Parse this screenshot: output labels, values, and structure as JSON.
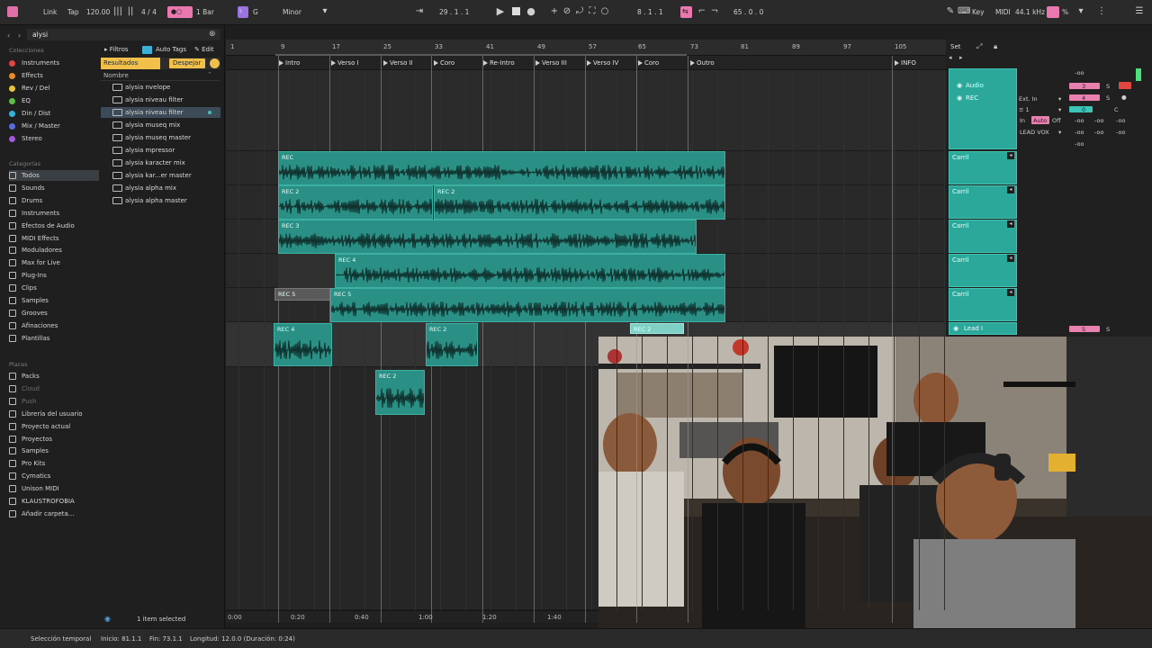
{
  "toolbar": {
    "link": "Link",
    "tap": "Tap",
    "tempo": "120.00",
    "signature": "4 / 4",
    "quantize": "1 Bar",
    "key": "G",
    "scale": "Minor",
    "position": "29 .   1 .   1",
    "loop_start": "8 .   1 .   1",
    "loop_length": "65 .   0 .   0",
    "key_label": "Key",
    "midi_label": "MIDI",
    "sample_rate": "44.1 kHz",
    "cpu_percent": "%"
  },
  "browser": {
    "search_value": "alysi",
    "collections_header": "Colecciones",
    "collections": [
      {
        "label": "Instruments",
        "color": "#e0473f"
      },
      {
        "label": "Effects",
        "color": "#e88a2d"
      },
      {
        "label": "Rev / Del",
        "color": "#e9c23f"
      },
      {
        "label": "EQ",
        "color": "#5bbf4a"
      },
      {
        "label": "Din / Dist",
        "color": "#36b0d8"
      },
      {
        "label": "Mix / Master",
        "color": "#5b6bdb"
      },
      {
        "label": "Stereo",
        "color": "#a25ad9"
      }
    ],
    "categories_header": "Categorías",
    "categories": [
      {
        "label": "Todos",
        "selected": true
      },
      {
        "label": "Sounds"
      },
      {
        "label": "Drums"
      },
      {
        "label": "Instruments"
      },
      {
        "label": "Efectos de Audio"
      },
      {
        "label": "MIDI Effects"
      },
      {
        "label": "Moduladores"
      },
      {
        "label": "Max for Live"
      },
      {
        "label": "Plug-Ins"
      },
      {
        "label": "Clips"
      },
      {
        "label": "Samples"
      },
      {
        "label": "Grooves"
      },
      {
        "label": "Afinaciones"
      },
      {
        "label": "Plantillas"
      }
    ],
    "places_header": "Places",
    "places": [
      {
        "label": "Packs"
      },
      {
        "label": "Cloud",
        "dim": true
      },
      {
        "label": "Push",
        "dim": true
      },
      {
        "label": "Librería del usuario"
      },
      {
        "label": "Proyecto actual"
      },
      {
        "label": "Proyectos"
      },
      {
        "label": "Samples"
      },
      {
        "label": "Pro Kits"
      },
      {
        "label": "Cymatics"
      },
      {
        "label": "Unison MIDI"
      },
      {
        "label": "KLAUSTROFOBIA"
      },
      {
        "label": "Añadir carpeta..."
      }
    ],
    "filters_label": "Filtros",
    "auto_tags_label": "Auto Tags",
    "edit_label": "Edit",
    "results_label": "Resultados",
    "clear_label": "Despejar",
    "name_header": "Nombre",
    "results": [
      {
        "label": "alysia nvelope"
      },
      {
        "label": "alysia niveau filter"
      },
      {
        "label": "alysia niveau filter",
        "selected": true
      },
      {
        "label": "alysia museq mix"
      },
      {
        "label": "alysia museq master"
      },
      {
        "label": "alysia mpressor"
      },
      {
        "label": "alysia karacter mix"
      },
      {
        "label": "alysia kar...er master"
      },
      {
        "label": "alysia alpha mix"
      },
      {
        "label": "alysia alpha master"
      }
    ],
    "selection_count": "1 item selected"
  },
  "arrangement": {
    "bar_numbers": [
      "1",
      "9",
      "17",
      "25",
      "33",
      "41",
      "49",
      "57",
      "65",
      "73",
      "81",
      "89",
      "97",
      "105"
    ],
    "locators": [
      "Intro",
      "Verso I",
      "Verso II",
      "Coro",
      "Re-Intro",
      "Verso III",
      "Verso IV",
      "Coro",
      "Outro",
      "INFO"
    ],
    "clips": [
      "REC",
      "REC 2",
      "REC 2",
      "REC 3",
      "REC 4",
      "REC 5",
      "REC 5",
      "REC 4",
      "REC 2",
      "REC 2",
      "REC 2"
    ],
    "time_markers": [
      "0:00",
      "0:20",
      "0:40",
      "1:00",
      "1:20",
      "1:40"
    ]
  },
  "mixer": {
    "set_label": "Set",
    "input_label": "Audio",
    "rec_label": "REC",
    "ext_in": "Ext. In",
    "channel": "1",
    "monitor_in": "In",
    "monitor_auto": "Auto",
    "monitor_off": "Off",
    "track_name": "LEAD VOX",
    "inf": "-oo",
    "send_value_a": "3",
    "send_value_b": "4",
    "solo": "S",
    "pan": "C",
    "zero": "0",
    "lanes": [
      "Carril",
      "Carril",
      "Carril",
      "Carril",
      "Carril"
    ],
    "lead_label": "Lead I",
    "lead_value": "5"
  },
  "status_bar": {
    "selection": "Selección temporal",
    "start": "Inicio: 81.1.1",
    "end": "Fin: 73.1.1",
    "length": "Longitud: 12.0.0 (Duración: 0:24)"
  },
  "colors": {
    "clip": "#2a8f85",
    "mixer_strip": "#2ca89b",
    "accent_pink": "#ea80b0",
    "accent_yellow": "#f5c542"
  },
  "webcam": {
    "description_icons": [
      "person",
      "person",
      "person",
      "person",
      "person"
    ]
  }
}
